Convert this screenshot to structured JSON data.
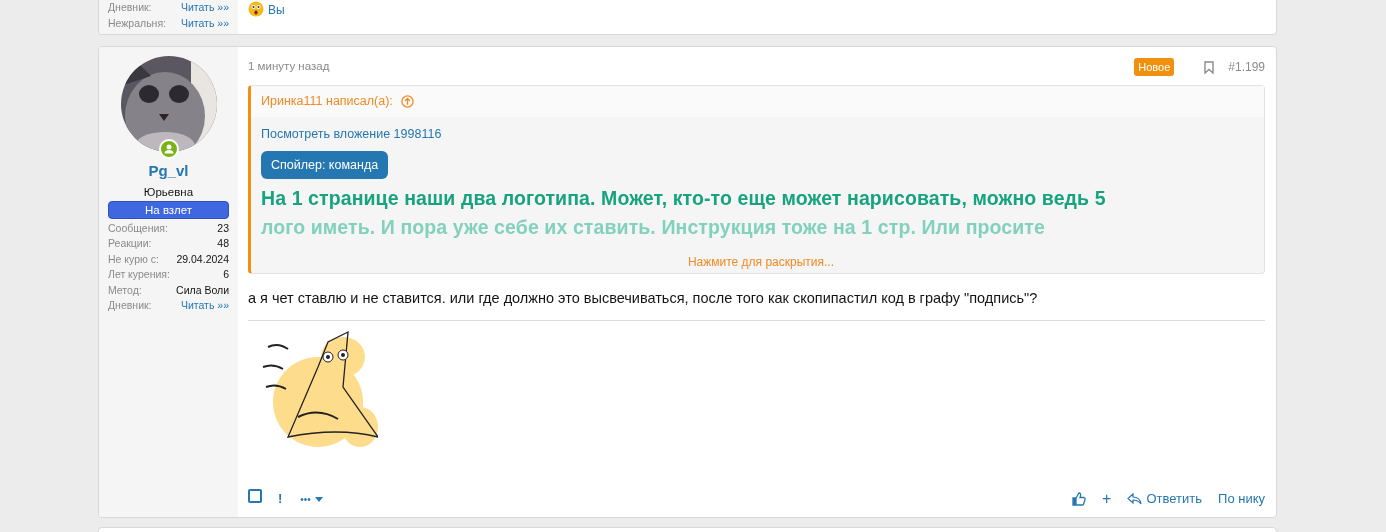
{
  "previous_post": {
    "user_stats": [
      {
        "label": "Дневник:",
        "value": "Читать »»",
        "kind": "link"
      },
      {
        "label": "Нежральня:",
        "value": "Читать »»",
        "kind": "link"
      }
    ],
    "reaction_users": "Вы"
  },
  "post": {
    "user": {
      "name": "Pg_vl",
      "title": "Юрьевна",
      "online": true,
      "banner": "На взлет",
      "stats": [
        {
          "label": "Сообщения:",
          "value": "23",
          "kind": "text"
        },
        {
          "label": "Реакции:",
          "value": "48",
          "kind": "text"
        },
        {
          "label": "Не курю с:",
          "value": "29.04.2024",
          "kind": "text"
        },
        {
          "label": "Лет курения:",
          "value": "6",
          "kind": "text"
        },
        {
          "label": "Метод:",
          "value": "Сила Воли",
          "kind": "text"
        },
        {
          "label": "Дневник:",
          "value": "Читать »»",
          "kind": "link"
        }
      ]
    },
    "time": "1 минуту назад",
    "new_badge": "Новое",
    "number": "#1.199",
    "quote": {
      "author": "Иринка111 написал(а):",
      "attachment_link": "Посмотреть вложение 1998116",
      "spoiler_button": "Спойлер: команда",
      "lines": [
        {
          "text": "На 1 странице наши два логотипа. Может, кто-то еще может нарисовать, можно ведь 5",
          "faded": false
        },
        {
          "text": "лого иметь. И пора уже себе их ставить. Инструкция тоже на 1 стр. Или просите",
          "faded": true
        }
      ],
      "expand": "Нажмите для раскрытия..."
    },
    "body": "а я чет ставлю и не ставится. или где должно это высвечиваться, после того как скопипастил код в графу \"подпись\"?",
    "select_checkbox": {
      "checked": false
    },
    "actions_left": [
      {
        "kind": "report",
        "label": "!"
      },
      {
        "kind": "more",
        "label": "•••"
      }
    ],
    "actions_right": [
      {
        "kind": "like"
      },
      {
        "kind": "text",
        "label": "+"
      },
      {
        "kind": "reply",
        "label": "Ответить"
      },
      {
        "kind": "text",
        "label": "По нику"
      }
    ]
  }
}
